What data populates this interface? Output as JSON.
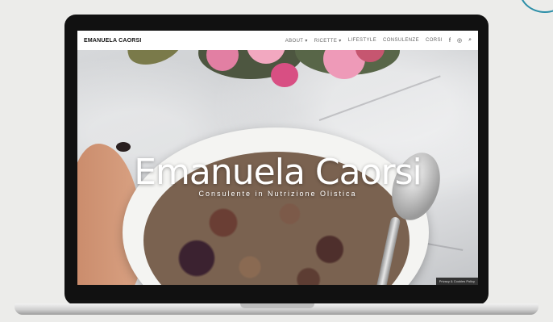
{
  "site": {
    "brand": "EMANUELA CAORSI",
    "nav": [
      {
        "label": "ABOUT ▾"
      },
      {
        "label": "RICETTE ▾"
      },
      {
        "label": "LIFESTYLE"
      },
      {
        "label": "CONSULENZE"
      },
      {
        "label": "CORSI"
      }
    ],
    "icons": {
      "facebook": "f",
      "instagram": "◎",
      "search": "⌕"
    },
    "hero": {
      "title": "Emanuela Caorsi",
      "subtitle": "Consulente in Nutrizione Olistica"
    },
    "privacy": "Privacy & Cookies Policy"
  },
  "colors": {
    "accent_ring": "#2d8fa8",
    "laptop_frame": "#111111"
  }
}
